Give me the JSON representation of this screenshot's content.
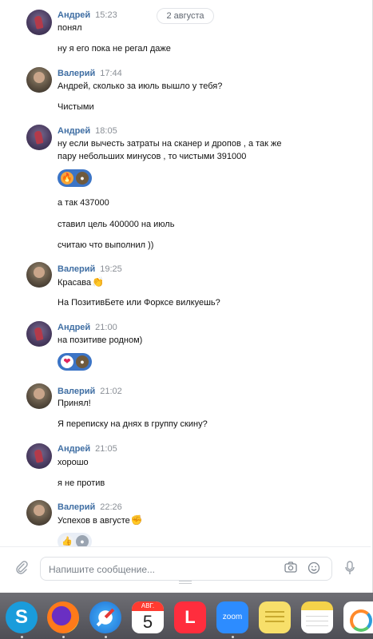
{
  "date_divider": "2 августа",
  "messages": [
    {
      "author": "Андрей",
      "time": "15:23",
      "lines": [
        "понял",
        "ну я его пока не регал даже"
      ]
    },
    {
      "author": "Валерий",
      "time": "17:44",
      "lines": [
        "Андрей, сколько за июль вышло у тебя?",
        "Чистыми"
      ]
    },
    {
      "author": "Андрей",
      "time": "18:05",
      "lines": [
        "ну если вычесть затраты на сканер и дропов , а так же",
        "пару небольших минусов , то чистыми 391000",
        "а так 437000",
        "ставил цель 400000 на июль",
        "считаю что выполнил ))"
      ]
    },
    {
      "author": "Валерий",
      "time": "19:25",
      "lines": [
        "Красава",
        "На ПозитивБете или Форксе вилкуешь?"
      ]
    },
    {
      "author": "Андрей",
      "time": "21:00",
      "lines": [
        "на позитиве родном)"
      ]
    },
    {
      "author": "Валерий",
      "time": "21:02",
      "lines": [
        "Принял!",
        "Я переписку на днях в группу скину?"
      ]
    },
    {
      "author": "Андрей",
      "time": "21:05",
      "lines": [
        "хорошо",
        "я не против"
      ]
    },
    {
      "author": "Валерий",
      "time": "22:26",
      "lines": [
        "Успехов в августе"
      ]
    }
  ],
  "emojis": {
    "clap": "👏",
    "fist": "✊"
  },
  "reactions": {
    "fire": "🔥",
    "heart": "❤",
    "thumb": "👍"
  },
  "composer": {
    "placeholder": "Напишите сообщение..."
  },
  "icons": {
    "attach": "paperclip-icon",
    "camera": "camera-icon",
    "emoji": "smiley-icon",
    "mic": "microphone-icon"
  },
  "dock": {
    "calendar_month": "АВГ.",
    "calendar_day": "5",
    "zoom_label": "zoom",
    "skype_letter": "S",
    "lol_letter": "L"
  }
}
